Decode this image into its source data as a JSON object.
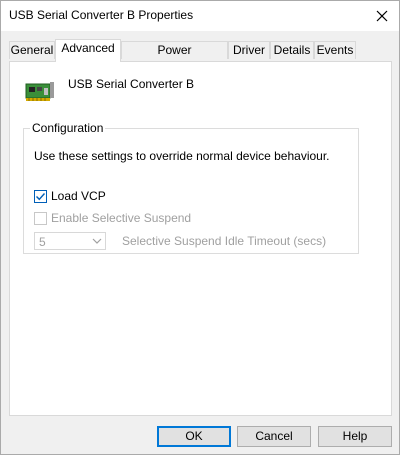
{
  "window": {
    "title": "USB Serial Converter B Properties",
    "close_icon": "close-icon"
  },
  "tabs": [
    {
      "label": "General",
      "active": false
    },
    {
      "label": "Advanced",
      "active": true
    },
    {
      "label": "Power Management",
      "active": false
    },
    {
      "label": "Driver",
      "active": false
    },
    {
      "label": "Details",
      "active": false
    },
    {
      "label": "Events",
      "active": false
    }
  ],
  "device": {
    "icon": "circuit-board-icon",
    "name": "USB Serial Converter B"
  },
  "configuration": {
    "group_label": "Configuration",
    "description": "Use these settings to override normal device behaviour.",
    "load_vcp": {
      "label": "Load VCP",
      "checked": true,
      "enabled": true
    },
    "selective_suspend": {
      "label": "Enable Selective Suspend",
      "checked": false,
      "enabled": false
    },
    "idle_timeout": {
      "value": "5",
      "label": "Selective Suspend Idle Timeout (secs)",
      "enabled": false
    }
  },
  "buttons": {
    "ok": "OK",
    "cancel": "Cancel",
    "help": "Help"
  },
  "colors": {
    "accent": "#0078d7",
    "checkbox_check": "#005fb8",
    "disabled_text": "#a0a0a0"
  }
}
